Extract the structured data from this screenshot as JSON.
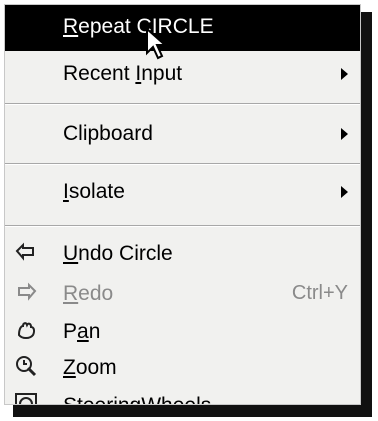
{
  "menu": {
    "items": [
      {
        "label": "Repeat CIRCLE",
        "underline_index": 0
      },
      {
        "label": "Recent Input",
        "underline_index": 7
      },
      {
        "label": "Clipboard"
      },
      {
        "label": "Isolate",
        "underline_index": 0
      },
      {
        "label": "Undo Circle",
        "underline_index": 0,
        "icon": "undo-icon"
      },
      {
        "label": "Redo",
        "underline_index": 0,
        "shortcut": "Ctrl+Y",
        "icon": "redo-icon"
      },
      {
        "label": "Pan",
        "underline_index": 1,
        "icon": "pan-hand-icon"
      },
      {
        "label": "Zoom",
        "underline_index": 0,
        "icon": "zoom-icon"
      },
      {
        "label": "SteeringWheels",
        "icon": "steering-wheels-icon"
      }
    ]
  },
  "colors": {
    "menu_bg": "#f1f1ef",
    "highlight_bg": "#000000",
    "highlight_text": "#ffffff",
    "disabled_text": "#8a8a8a",
    "shadow": "#111111"
  }
}
